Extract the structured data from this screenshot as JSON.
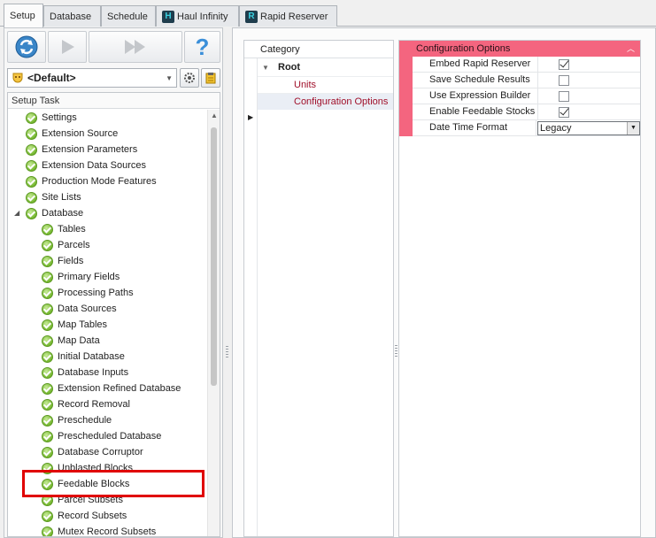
{
  "tabs": [
    {
      "label": "Setup",
      "active": true
    },
    {
      "label": "Database",
      "active": false
    },
    {
      "label": "Schedule",
      "active": false
    },
    {
      "label": "Haul Infinity",
      "active": false,
      "icon": "H"
    },
    {
      "label": "Rapid Reserver",
      "active": false,
      "icon": "R"
    }
  ],
  "toolbar": {
    "refresh_icon": "refresh-icon",
    "play_icon": "play-icon",
    "fast_forward_icon": "fast-forward-icon",
    "help_icon": "question-icon",
    "help_glyph": "?"
  },
  "profile": {
    "selected": "<Default>"
  },
  "setup_task": {
    "header": "Setup Task",
    "items": [
      {
        "label": "Settings",
        "level": 0
      },
      {
        "label": "Extension Source",
        "level": 0
      },
      {
        "label": "Extension Parameters",
        "level": 0
      },
      {
        "label": "Extension Data Sources",
        "level": 0
      },
      {
        "label": "Production Mode Features",
        "level": 0
      },
      {
        "label": "Site Lists",
        "level": 0
      },
      {
        "label": "Database",
        "level": 0,
        "expanded": true
      },
      {
        "label": "Tables",
        "level": 1
      },
      {
        "label": "Parcels",
        "level": 1
      },
      {
        "label": "Fields",
        "level": 1
      },
      {
        "label": "Primary Fields",
        "level": 1
      },
      {
        "label": "Processing Paths",
        "level": 1
      },
      {
        "label": "Data Sources",
        "level": 1
      },
      {
        "label": "Map Tables",
        "level": 1
      },
      {
        "label": "Map Data",
        "level": 1
      },
      {
        "label": "Initial Database",
        "level": 1
      },
      {
        "label": "Database Inputs",
        "level": 1
      },
      {
        "label": "Extension Refined Database",
        "level": 1
      },
      {
        "label": "Record Removal",
        "level": 1
      },
      {
        "label": "Preschedule",
        "level": 1
      },
      {
        "label": "Prescheduled Database",
        "level": 1
      },
      {
        "label": "Database Corruptor",
        "level": 1
      },
      {
        "label": "Unblasted Blocks",
        "level": 1
      },
      {
        "label": "Feedable Blocks",
        "level": 1,
        "highlighted": true
      },
      {
        "label": "Parcel Subsets",
        "level": 1
      },
      {
        "label": "Record Subsets",
        "level": 1
      },
      {
        "label": "Mutex Record Subsets",
        "level": 1
      }
    ]
  },
  "category": {
    "header": "Category",
    "root": "Root",
    "children": [
      {
        "label": "Units",
        "selected": false
      },
      {
        "label": "Configuration Options",
        "selected": true
      }
    ]
  },
  "config": {
    "title": "Configuration Options",
    "properties": [
      {
        "name": "Embed Rapid Reserver",
        "type": "checkbox",
        "checked": true
      },
      {
        "name": "Save Schedule Results",
        "type": "checkbox",
        "checked": false
      },
      {
        "name": "Use Expression Builder",
        "type": "checkbox",
        "checked": false
      },
      {
        "name": "Enable Feedable Stocks",
        "type": "checkbox",
        "checked": true
      },
      {
        "name": "Date Time Format",
        "type": "dropdown",
        "value": "Legacy"
      }
    ]
  },
  "colors": {
    "accent_pink": "#f4657f",
    "category_text": "#a0102a",
    "highlight_red": "#e00000"
  }
}
